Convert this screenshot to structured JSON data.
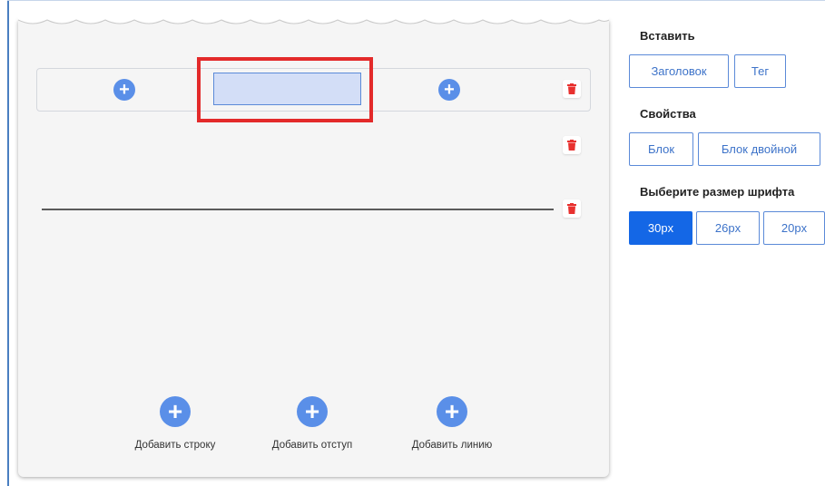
{
  "canvas": {
    "bottom_actions": [
      {
        "icon": "plus-icon",
        "label": "Добавить строку"
      },
      {
        "icon": "plus-icon",
        "label": "Добавить отступ"
      },
      {
        "icon": "plus-icon",
        "label": "Добавить линию"
      }
    ]
  },
  "panel": {
    "insert_title": "Вставить",
    "insert_buttons": [
      "Заголовок",
      "Тег"
    ],
    "properties_title": "Свойства",
    "properties_buttons": [
      "Блок",
      "Блок двойной"
    ],
    "font_title": "Выберите размер шрифта",
    "font_sizes": [
      "30px",
      "26px",
      "20px"
    ],
    "selected_font_size": "30px"
  },
  "colors": {
    "accent": "#1467e6",
    "plus_icon": "#5a8fe8",
    "delete_icon": "#e8312f",
    "highlight": "#e32a2a"
  }
}
